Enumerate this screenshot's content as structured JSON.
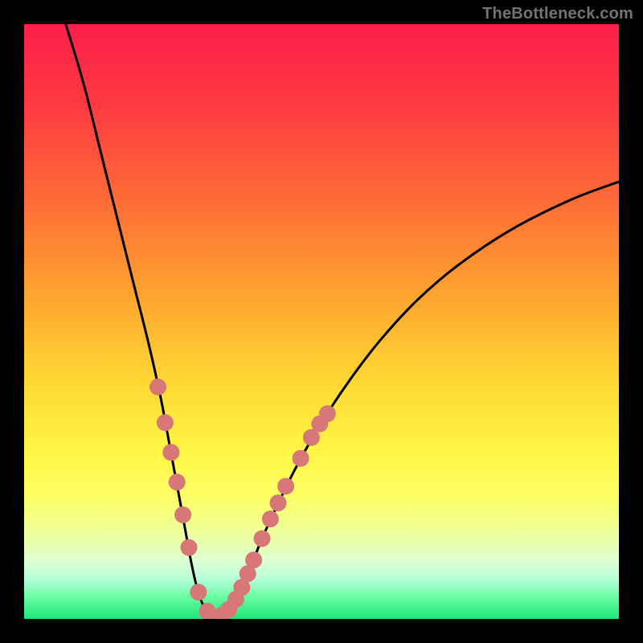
{
  "attribution": "TheBottleneck.com",
  "colors": {
    "frame": "#000000",
    "curve": "#000000",
    "marker": "#d77777",
    "gradient_stops": [
      {
        "offset": 0.0,
        "color": "#fd1e4a"
      },
      {
        "offset": 0.14,
        "color": "#fe3b41"
      },
      {
        "offset": 0.3,
        "color": "#fe6d36"
      },
      {
        "offset": 0.45,
        "color": "#fea22f"
      },
      {
        "offset": 0.6,
        "color": "#fed734"
      },
      {
        "offset": 0.72,
        "color": "#fff645"
      },
      {
        "offset": 0.8,
        "color": "#fbff68"
      },
      {
        "offset": 0.86,
        "color": "#edffa0"
      },
      {
        "offset": 0.905,
        "color": "#dcffd4"
      },
      {
        "offset": 0.935,
        "color": "#b1ffd7"
      },
      {
        "offset": 0.965,
        "color": "#64fca0"
      },
      {
        "offset": 1.0,
        "color": "#1de876"
      }
    ]
  },
  "chart_data": {
    "type": "line",
    "title": "",
    "xlabel": "",
    "ylabel": "",
    "xlim": [
      0,
      100
    ],
    "ylim": [
      0,
      100
    ],
    "series": [
      {
        "name": "bottleneck-curve",
        "x": [
          7,
          10,
          13,
          16,
          18.5,
          21,
          23,
          24.5,
          25.8,
          27,
          28,
          29,
          30,
          31,
          32,
          33,
          34.5,
          36,
          38,
          40,
          43,
          46,
          50,
          55,
          60,
          66,
          73,
          82,
          92,
          100
        ],
        "y": [
          100,
          90,
          78,
          66,
          56,
          46,
          37,
          29,
          22,
          15.5,
          10,
          5.5,
          2.5,
          0.8,
          0.2,
          0.6,
          1.8,
          4.2,
          8.5,
          13.5,
          20,
          26,
          33,
          40.5,
          47,
          53.5,
          59.5,
          65.5,
          70.5,
          73.5
        ]
      }
    ],
    "markers": {
      "name": "highlighted-points",
      "points": [
        {
          "x": 22.5,
          "y": 39
        },
        {
          "x": 23.7,
          "y": 33
        },
        {
          "x": 24.7,
          "y": 28
        },
        {
          "x": 25.7,
          "y": 23
        },
        {
          "x": 26.7,
          "y": 17.5
        },
        {
          "x": 27.7,
          "y": 12
        },
        {
          "x": 29.3,
          "y": 4.5
        },
        {
          "x": 30.8,
          "y": 1.3
        },
        {
          "x": 32.0,
          "y": 0.2
        },
        {
          "x": 33.2,
          "y": 0.6
        },
        {
          "x": 34.4,
          "y": 1.6
        },
        {
          "x": 35.6,
          "y": 3.3
        },
        {
          "x": 36.6,
          "y": 5.3
        },
        {
          "x": 37.6,
          "y": 7.6
        },
        {
          "x": 38.6,
          "y": 9.9
        },
        {
          "x": 40.0,
          "y": 13.5
        },
        {
          "x": 41.4,
          "y": 16.8
        },
        {
          "x": 42.7,
          "y": 19.5
        },
        {
          "x": 44.0,
          "y": 22.3
        },
        {
          "x": 46.5,
          "y": 27
        },
        {
          "x": 48.3,
          "y": 30.5
        },
        {
          "x": 49.7,
          "y": 32.8
        },
        {
          "x": 51.0,
          "y": 34.5
        }
      ]
    }
  }
}
